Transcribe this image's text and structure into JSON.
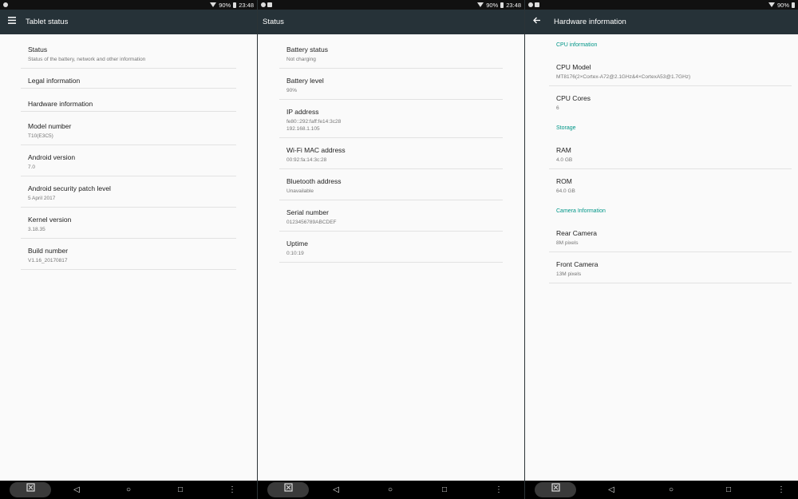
{
  "status_bar": {
    "battery_percent": "90%",
    "time": "23:48"
  },
  "panels": {
    "tablet_status": {
      "title": "Tablet status",
      "menu_icon": "hamburger-menu-icon",
      "items": [
        {
          "title": "Status",
          "summary": "Status of the battery, network and other information"
        },
        {
          "title": "Legal information"
        },
        {
          "title": "Hardware information"
        },
        {
          "title": "Model number",
          "summary": "T10(E3C5)"
        },
        {
          "title": "Android version",
          "summary": "7.0"
        },
        {
          "title": "Android security patch level",
          "summary": "5 April 2017"
        },
        {
          "title": "Kernel version",
          "summary": "3.18.35"
        },
        {
          "title": "Build number",
          "summary": "V1.16_20170817"
        }
      ]
    },
    "status": {
      "title": "Status",
      "items": [
        {
          "title": "Battery status",
          "summary": "Not charging"
        },
        {
          "title": "Battery level",
          "summary": "90%"
        },
        {
          "title": "IP address",
          "summary": "fe80::292:faff:fe14:3c28",
          "summary2": "192.168.1.105"
        },
        {
          "title": "Wi-Fi MAC address",
          "summary": "00:92:fa:14:3c:28"
        },
        {
          "title": "Bluetooth address",
          "summary": "Unavailable"
        },
        {
          "title": "Serial number",
          "summary": "0123456789ABCDEF"
        },
        {
          "title": "Uptime",
          "summary": "0:10:19"
        }
      ]
    },
    "hardware": {
      "title": "Hardware information",
      "back_icon": "back-arrow-icon",
      "sections": [
        {
          "header": "CPU information",
          "items": [
            {
              "title": "CPU Model",
              "summary": "MT8176(2×Cortex-A72@2.1GHz&4×CortexA53@1.7GHz)"
            },
            {
              "title": "CPU Cores",
              "summary": "6"
            }
          ]
        },
        {
          "header": "Storage",
          "items": [
            {
              "title": "RAM",
              "summary": "4.0 GB"
            },
            {
              "title": "ROM",
              "summary": "64.0 GB"
            }
          ]
        },
        {
          "header": "Camera Information",
          "items": [
            {
              "title": "Rear Camera",
              "summary": "8M pixels"
            },
            {
              "title": "Front Camera",
              "summary": "13M pixels"
            }
          ]
        }
      ]
    }
  },
  "nav_bar": {
    "screenshot_icon": "screenshot-icon",
    "back": "◁",
    "home": "○",
    "recents": "□",
    "more": "⋮"
  },
  "colors": {
    "toolbar": "#263238",
    "accent": "#009688",
    "background": "#fafafa"
  }
}
